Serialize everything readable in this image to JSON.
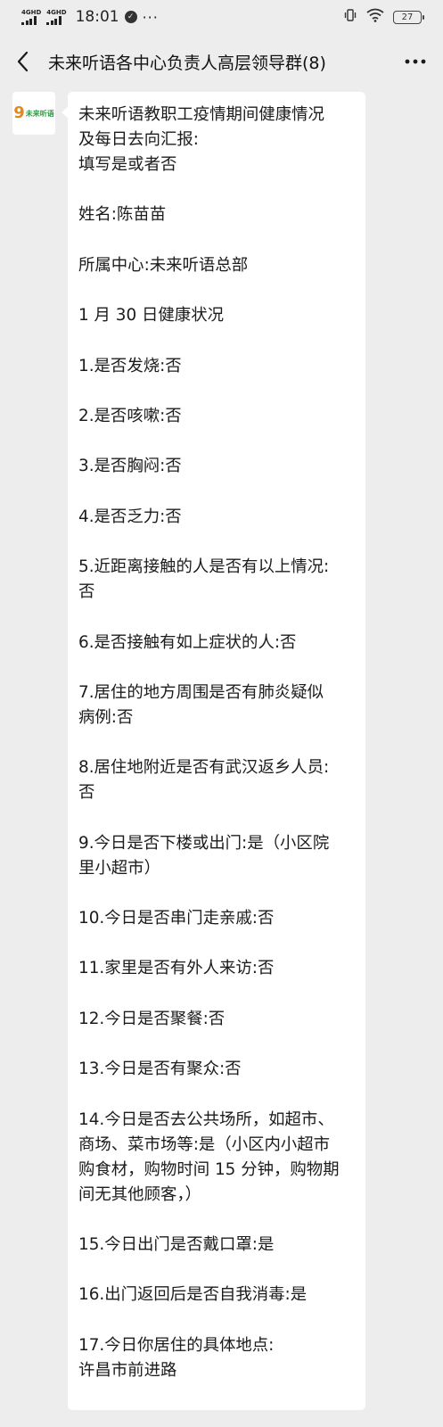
{
  "status_bar": {
    "sim1_label": "4GHD",
    "sim2_label": "4GHD",
    "time": "18:01",
    "more": "···",
    "battery": "27",
    "icons": [
      "vibrate-icon",
      "wifi-icon",
      "battery-icon"
    ]
  },
  "header": {
    "back_icon": "chevron-left-icon",
    "title": "未来听语各中心负责人高层领导群(8)",
    "more_icon": "more-dots-icon"
  },
  "message": {
    "avatar_text": "未来听语",
    "paragraphs": [
      [
        "未来听语教职工疫情期间健康情况",
        "及每日去向汇报:",
        "填写是或者否"
      ],
      [
        "姓名:陈苗苗"
      ],
      [
        "所属中心:未来听语总部"
      ],
      [
        "1 月 30 日健康状况"
      ],
      [
        "1.是否发烧:否"
      ],
      [
        "2.是否咳嗽:否"
      ],
      [
        "3.是否胸闷:否"
      ],
      [
        "4.是否乏力:否"
      ],
      [
        "5.近距离接触的人是否有以上情况:",
        "否"
      ],
      [
        "6.是否接触有如上症状的人:否"
      ],
      [
        "7.居住的地方周围是否有肺炎疑似",
        "病例:否"
      ],
      [
        "8.居住地附近是否有武汉返乡人员:",
        "否"
      ],
      [
        "9.今日是否下楼或出门:是（小区院",
        "里小超市）"
      ],
      [
        "10.今日是否串门走亲戚:否"
      ],
      [
        "11.家里是否有外人来访:否"
      ],
      [
        "12.今日是否聚餐:否"
      ],
      [
        "13.今日是否有聚众:否"
      ],
      [
        "14.今日是否去公共场所，如超市、",
        "商场、菜市场等:是（小区内小超市",
        "购食材，购物时间 15 分钟，购物期",
        "间无其他顾客，）"
      ],
      [
        "15.今日出门是否戴口罩:是"
      ],
      [
        "16.出门返回后是否自我消毒:是"
      ],
      [
        "17.今日你居住的具体地点:",
        "许昌市前进路"
      ]
    ]
  }
}
